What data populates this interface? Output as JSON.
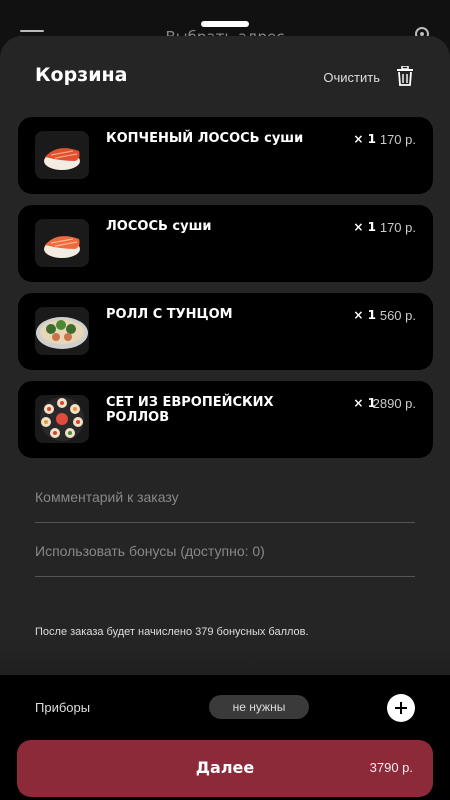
{
  "background": {
    "title": "Выбрать адрес"
  },
  "cart": {
    "title": "Корзина",
    "clear_label": "Очистить",
    "currency": "р.",
    "items": [
      {
        "name": "КОПЧЕНЫЙ  ЛОСОСЬ суши",
        "qty": "× 1",
        "price": "170 р.",
        "image": "smoked-salmon-sushi"
      },
      {
        "name": "ЛОСОСЬ суши",
        "qty": "× 1",
        "price": "170 р.",
        "image": "salmon-sushi"
      },
      {
        "name": "РОЛЛ С  ТУНЦОМ",
        "qty": "× 1",
        "price": "560 р.",
        "image": "tuna-roll"
      },
      {
        "name": "СЕТ ИЗ ЕВРОПЕЙСКИХ РОЛЛОВ",
        "qty": "× 1",
        "price": "2890 р.",
        "image": "european-rolls-set"
      }
    ],
    "comment": {
      "placeholder": "Комментарий к заказу",
      "value": ""
    },
    "bonus": {
      "placeholder": "Использовать бонусы (доступно: 0)",
      "value": ""
    },
    "bonus_note": "После заказа будет начислено 379 бонусных баллов."
  },
  "bottom": {
    "cutlery_label": "Приборы",
    "cutlery_value": "не нужны",
    "next_label": "Далее",
    "total": "3790 р."
  },
  "colors": {
    "sheet": "#252525",
    "card": "#000000",
    "accent": "#8c2a39"
  }
}
